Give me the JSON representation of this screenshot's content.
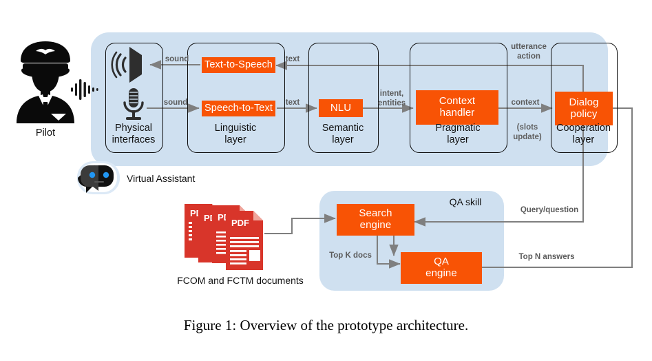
{
  "figure": {
    "caption": "Figure 1: Overview of the prototype architecture."
  },
  "actors": {
    "pilot_label": "Pilot",
    "pilot_icon": "pilot-silhouette-icon",
    "voice_icon": "audio-waveform-icon",
    "assistant_label": "Virtual Assistant",
    "assistant_icon": "chatbot-face-icon"
  },
  "virtual_assistant_panel": {
    "layers": [
      {
        "id": "physical",
        "label": "Physical\ninterfaces"
      },
      {
        "id": "linguistic",
        "label": "Linguistic\nlayer"
      },
      {
        "id": "semantic",
        "label": "Semantic\nlayer"
      },
      {
        "id": "pragmatic",
        "label": "Pragmatic\nlayer"
      },
      {
        "id": "cooperation",
        "label": "Cooperation\nlayer"
      }
    ],
    "modules": [
      {
        "id": "tts",
        "label": "Text-to-Speech"
      },
      {
        "id": "stt",
        "label": "Speech-to-Text"
      },
      {
        "id": "nlu",
        "label": "NLU"
      },
      {
        "id": "context_handler",
        "label": "Context\nhandler"
      },
      {
        "id": "dialog_policy",
        "label": "Dialog\npolicy"
      }
    ],
    "icons": [
      {
        "id": "speaker",
        "name": "speaker-icon"
      },
      {
        "id": "microphone",
        "name": "microphone-icon"
      }
    ]
  },
  "qa_skill": {
    "title": "QA skill",
    "modules": [
      {
        "id": "search_engine",
        "label": "Search\nengine"
      },
      {
        "id": "qa_engine",
        "label": "QA\nengine"
      }
    ]
  },
  "documents": {
    "label": "FCOM and FCTM documents",
    "icon": "pdf-document-stack-icon",
    "badge": "PDF",
    "count": 4
  },
  "edge_labels": {
    "sound_out": "sound",
    "sound_in": "sound",
    "text_out": "text",
    "text_in": "text",
    "intent_entities": "intent,\nentities",
    "context": "context",
    "slots_update": "(slots\nupdate)",
    "utterance_action": "utterance\naction",
    "query_question": "Query/question",
    "top_k_docs": "Top K docs",
    "top_n_answers": "Top N answers"
  },
  "colors": {
    "module_orange": "#f85305",
    "panel_blue": "#cfe0f0",
    "arrow_gray": "#7f7f7f",
    "pdf_red": "#d8352a",
    "outline_black": "#0d0d0d",
    "label_gray": "#5b5b5b",
    "eye_blue": "#2196f3"
  }
}
